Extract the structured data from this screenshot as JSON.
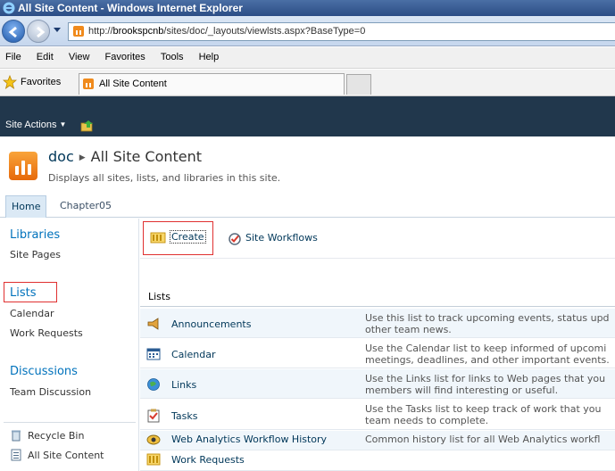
{
  "window": {
    "title": "All Site Content - Windows Internet Explorer"
  },
  "address": {
    "url_prefix": "http://",
    "url_host": "brookspcnb",
    "url_path": "/sites/doc/_layouts/viewlsts.aspx?BaseType=0"
  },
  "menu": [
    "File",
    "Edit",
    "View",
    "Favorites",
    "Tools",
    "Help"
  ],
  "favorites": {
    "label": "Favorites",
    "tab_title": "All Site Content"
  },
  "site": {
    "actions_label": "Site Actions"
  },
  "title_area": {
    "site_name": "doc",
    "page_title": "All Site Content",
    "description": "Displays all sites, lists, and libraries in this site."
  },
  "top_nav": {
    "tabs": [
      "Home",
      "Chapter05"
    ]
  },
  "left_nav": {
    "libraries_heading": "Libraries",
    "libraries": [
      "Site Pages"
    ],
    "lists_heading": "Lists",
    "lists": [
      "Calendar",
      "Work Requests"
    ],
    "discussions_heading": "Discussions",
    "discussions": [
      "Team Discussion"
    ],
    "bottom": [
      "Recycle Bin",
      "All Site Content"
    ]
  },
  "toolbar": {
    "create_label": "Create",
    "workflows_label": "Site Workflows"
  },
  "section": {
    "heading": "Lists"
  },
  "rows": [
    {
      "name": "Announcements",
      "desc1": "Use this list to track upcoming events, status upd",
      "desc2": "other team news."
    },
    {
      "name": "Calendar",
      "desc1": "Use the Calendar list to keep informed of upcomi",
      "desc2": "meetings, deadlines, and other important events."
    },
    {
      "name": "Links",
      "desc1": "Use the Links list for links to Web pages that you",
      "desc2": "members will find interesting or useful."
    },
    {
      "name": "Tasks",
      "desc1": "Use the Tasks list to keep track of work that you",
      "desc2": "team needs to complete."
    },
    {
      "name": "Web Analytics Workflow History",
      "desc1": "Common history list for all Web Analytics workfl",
      "desc2": ""
    },
    {
      "name": "Work Requests",
      "desc1": "",
      "desc2": ""
    }
  ],
  "colors": {
    "accent": "#0072bc",
    "ribbon": "#21374c",
    "highlight_box": "#e03030"
  }
}
